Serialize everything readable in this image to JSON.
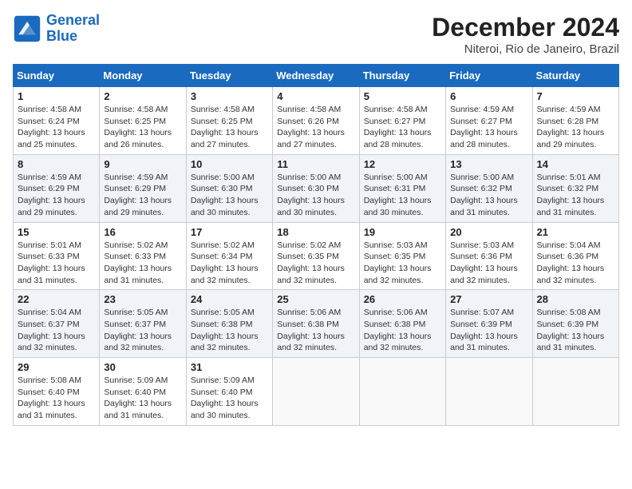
{
  "header": {
    "logo_line1": "General",
    "logo_line2": "Blue",
    "month_title": "December 2024",
    "location": "Niteroi, Rio de Janeiro, Brazil"
  },
  "weekdays": [
    "Sunday",
    "Monday",
    "Tuesday",
    "Wednesday",
    "Thursday",
    "Friday",
    "Saturday"
  ],
  "weeks": [
    [
      {
        "day": "1",
        "sunrise": "Sunrise: 4:58 AM",
        "sunset": "Sunset: 6:24 PM",
        "daylight": "Daylight: 13 hours and 25 minutes."
      },
      {
        "day": "2",
        "sunrise": "Sunrise: 4:58 AM",
        "sunset": "Sunset: 6:25 PM",
        "daylight": "Daylight: 13 hours and 26 minutes."
      },
      {
        "day": "3",
        "sunrise": "Sunrise: 4:58 AM",
        "sunset": "Sunset: 6:25 PM",
        "daylight": "Daylight: 13 hours and 27 minutes."
      },
      {
        "day": "4",
        "sunrise": "Sunrise: 4:58 AM",
        "sunset": "Sunset: 6:26 PM",
        "daylight": "Daylight: 13 hours and 27 minutes."
      },
      {
        "day": "5",
        "sunrise": "Sunrise: 4:58 AM",
        "sunset": "Sunset: 6:27 PM",
        "daylight": "Daylight: 13 hours and 28 minutes."
      },
      {
        "day": "6",
        "sunrise": "Sunrise: 4:59 AM",
        "sunset": "Sunset: 6:27 PM",
        "daylight": "Daylight: 13 hours and 28 minutes."
      },
      {
        "day": "7",
        "sunrise": "Sunrise: 4:59 AM",
        "sunset": "Sunset: 6:28 PM",
        "daylight": "Daylight: 13 hours and 29 minutes."
      }
    ],
    [
      {
        "day": "8",
        "sunrise": "Sunrise: 4:59 AM",
        "sunset": "Sunset: 6:29 PM",
        "daylight": "Daylight: 13 hours and 29 minutes."
      },
      {
        "day": "9",
        "sunrise": "Sunrise: 4:59 AM",
        "sunset": "Sunset: 6:29 PM",
        "daylight": "Daylight: 13 hours and 29 minutes."
      },
      {
        "day": "10",
        "sunrise": "Sunrise: 5:00 AM",
        "sunset": "Sunset: 6:30 PM",
        "daylight": "Daylight: 13 hours and 30 minutes."
      },
      {
        "day": "11",
        "sunrise": "Sunrise: 5:00 AM",
        "sunset": "Sunset: 6:30 PM",
        "daylight": "Daylight: 13 hours and 30 minutes."
      },
      {
        "day": "12",
        "sunrise": "Sunrise: 5:00 AM",
        "sunset": "Sunset: 6:31 PM",
        "daylight": "Daylight: 13 hours and 30 minutes."
      },
      {
        "day": "13",
        "sunrise": "Sunrise: 5:00 AM",
        "sunset": "Sunset: 6:32 PM",
        "daylight": "Daylight: 13 hours and 31 minutes."
      },
      {
        "day": "14",
        "sunrise": "Sunrise: 5:01 AM",
        "sunset": "Sunset: 6:32 PM",
        "daylight": "Daylight: 13 hours and 31 minutes."
      }
    ],
    [
      {
        "day": "15",
        "sunrise": "Sunrise: 5:01 AM",
        "sunset": "Sunset: 6:33 PM",
        "daylight": "Daylight: 13 hours and 31 minutes."
      },
      {
        "day": "16",
        "sunrise": "Sunrise: 5:02 AM",
        "sunset": "Sunset: 6:33 PM",
        "daylight": "Daylight: 13 hours and 31 minutes."
      },
      {
        "day": "17",
        "sunrise": "Sunrise: 5:02 AM",
        "sunset": "Sunset: 6:34 PM",
        "daylight": "Daylight: 13 hours and 32 minutes."
      },
      {
        "day": "18",
        "sunrise": "Sunrise: 5:02 AM",
        "sunset": "Sunset: 6:35 PM",
        "daylight": "Daylight: 13 hours and 32 minutes."
      },
      {
        "day": "19",
        "sunrise": "Sunrise: 5:03 AM",
        "sunset": "Sunset: 6:35 PM",
        "daylight": "Daylight: 13 hours and 32 minutes."
      },
      {
        "day": "20",
        "sunrise": "Sunrise: 5:03 AM",
        "sunset": "Sunset: 6:36 PM",
        "daylight": "Daylight: 13 hours and 32 minutes."
      },
      {
        "day": "21",
        "sunrise": "Sunrise: 5:04 AM",
        "sunset": "Sunset: 6:36 PM",
        "daylight": "Daylight: 13 hours and 32 minutes."
      }
    ],
    [
      {
        "day": "22",
        "sunrise": "Sunrise: 5:04 AM",
        "sunset": "Sunset: 6:37 PM",
        "daylight": "Daylight: 13 hours and 32 minutes."
      },
      {
        "day": "23",
        "sunrise": "Sunrise: 5:05 AM",
        "sunset": "Sunset: 6:37 PM",
        "daylight": "Daylight: 13 hours and 32 minutes."
      },
      {
        "day": "24",
        "sunrise": "Sunrise: 5:05 AM",
        "sunset": "Sunset: 6:38 PM",
        "daylight": "Daylight: 13 hours and 32 minutes."
      },
      {
        "day": "25",
        "sunrise": "Sunrise: 5:06 AM",
        "sunset": "Sunset: 6:38 PM",
        "daylight": "Daylight: 13 hours and 32 minutes."
      },
      {
        "day": "26",
        "sunrise": "Sunrise: 5:06 AM",
        "sunset": "Sunset: 6:38 PM",
        "daylight": "Daylight: 13 hours and 32 minutes."
      },
      {
        "day": "27",
        "sunrise": "Sunrise: 5:07 AM",
        "sunset": "Sunset: 6:39 PM",
        "daylight": "Daylight: 13 hours and 31 minutes."
      },
      {
        "day": "28",
        "sunrise": "Sunrise: 5:08 AM",
        "sunset": "Sunset: 6:39 PM",
        "daylight": "Daylight: 13 hours and 31 minutes."
      }
    ],
    [
      {
        "day": "29",
        "sunrise": "Sunrise: 5:08 AM",
        "sunset": "Sunset: 6:40 PM",
        "daylight": "Daylight: 13 hours and 31 minutes."
      },
      {
        "day": "30",
        "sunrise": "Sunrise: 5:09 AM",
        "sunset": "Sunset: 6:40 PM",
        "daylight": "Daylight: 13 hours and 31 minutes."
      },
      {
        "day": "31",
        "sunrise": "Sunrise: 5:09 AM",
        "sunset": "Sunset: 6:40 PM",
        "daylight": "Daylight: 13 hours and 30 minutes."
      },
      null,
      null,
      null,
      null
    ]
  ]
}
